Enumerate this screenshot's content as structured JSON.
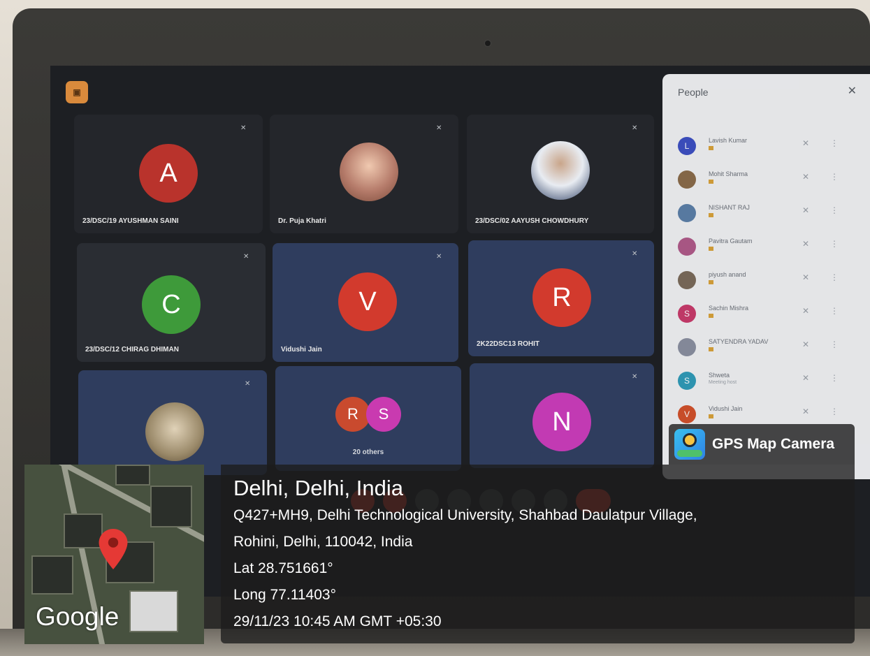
{
  "meeting": {
    "tiles": [
      {
        "label": "23/DSC/19 AYUSHMAN SAINI",
        "initial": "A",
        "color": "#b9332c"
      },
      {
        "label": "Dr. Puja Khatri",
        "initial": "",
        "color": "#b57b6a"
      },
      {
        "label": "23/DSC/02 AAYUSH CHOWDHURY",
        "initial": "",
        "color": "#dfe3ea"
      },
      {
        "label": "23/DSC/12 CHIRAG DHIMAN",
        "initial": "C",
        "color": "#3e9a3a"
      },
      {
        "label": "Vidushi Jain",
        "initial": "V",
        "color": "#d23a2d"
      },
      {
        "label": "2K22DSC13 ROHIT",
        "initial": "R",
        "color": "#d23a2d"
      },
      {
        "label": "",
        "initial": "",
        "color": "#c5b8a0"
      },
      {
        "label": "20 others",
        "initial": "",
        "color": ""
      },
      {
        "label": "",
        "initial": "N",
        "color": "#c23ab3"
      }
    ],
    "others_avatars": [
      {
        "initial": "R",
        "color": "#c94a2e"
      },
      {
        "initial": "S",
        "color": "#c93ab0"
      }
    ]
  },
  "people_panel": {
    "title": "People",
    "close_icon": "close-icon",
    "participants": [
      {
        "name": "Lavish Kumar",
        "initial": "L",
        "color": "#3c4fc3",
        "sub": ""
      },
      {
        "name": "Mohit Sharma",
        "initial": "",
        "color": "#8a6b4a",
        "sub": ""
      },
      {
        "name": "NISHANT RAJ",
        "initial": "",
        "color": "#5b7fa8",
        "sub": ""
      },
      {
        "name": "Pavitra Gautam",
        "initial": "",
        "color": "#b05a8a",
        "sub": ""
      },
      {
        "name": "piyush anand",
        "initial": "",
        "color": "#7a6a5a",
        "sub": ""
      },
      {
        "name": "Sachin Mishra",
        "initial": "S",
        "color": "#c93a6b",
        "sub": ""
      },
      {
        "name": "SATYENDRA YADAV",
        "initial": "",
        "color": "#8a8fa0",
        "sub": ""
      },
      {
        "name": "Shweta",
        "initial": "S",
        "color": "#2f9bb8",
        "sub": "Meeting host"
      },
      {
        "name": "Vidushi Jain",
        "initial": "V",
        "color": "#d2502a",
        "sub": ""
      }
    ]
  },
  "gps": {
    "brand": "GPS Map Camera",
    "map_logo": "Google",
    "city": "Delhi, Delhi, India",
    "address_line1": "Q427+MH9, Delhi Technological University, Shahbad Daulatpur Village,",
    "address_line2": "Rohini, Delhi, 110042, India",
    "lat": "Lat 28.751661°",
    "long": "Long 77.11403°",
    "datetime": "29/11/23 10:45 AM GMT +05:30"
  }
}
